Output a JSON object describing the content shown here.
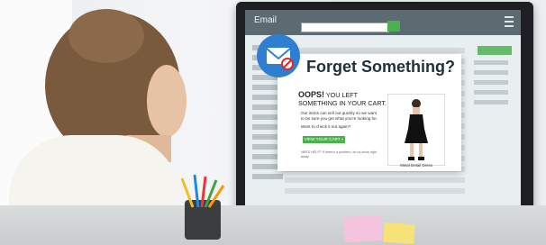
{
  "email": {
    "title": "Email"
  },
  "popup": {
    "headline": "Forget Something?",
    "oops_bold": "OOPS!",
    "oops_rest": "YOU LEFT SOMETHING IN YOUR CART.",
    "body": "Our items can sell out quickly so we want to be sure you get what you're looking for.",
    "prompt": "Want to check it out again?",
    "button": "VIEW YOUR CART »",
    "fine_print": "NEED HELP? If there's a problem, let us know right away.",
    "product_name": "Metal Detail Dress"
  },
  "colors": {
    "accent": "#4caf50",
    "brand": "#2e7fd1",
    "headline": "#21303d"
  }
}
